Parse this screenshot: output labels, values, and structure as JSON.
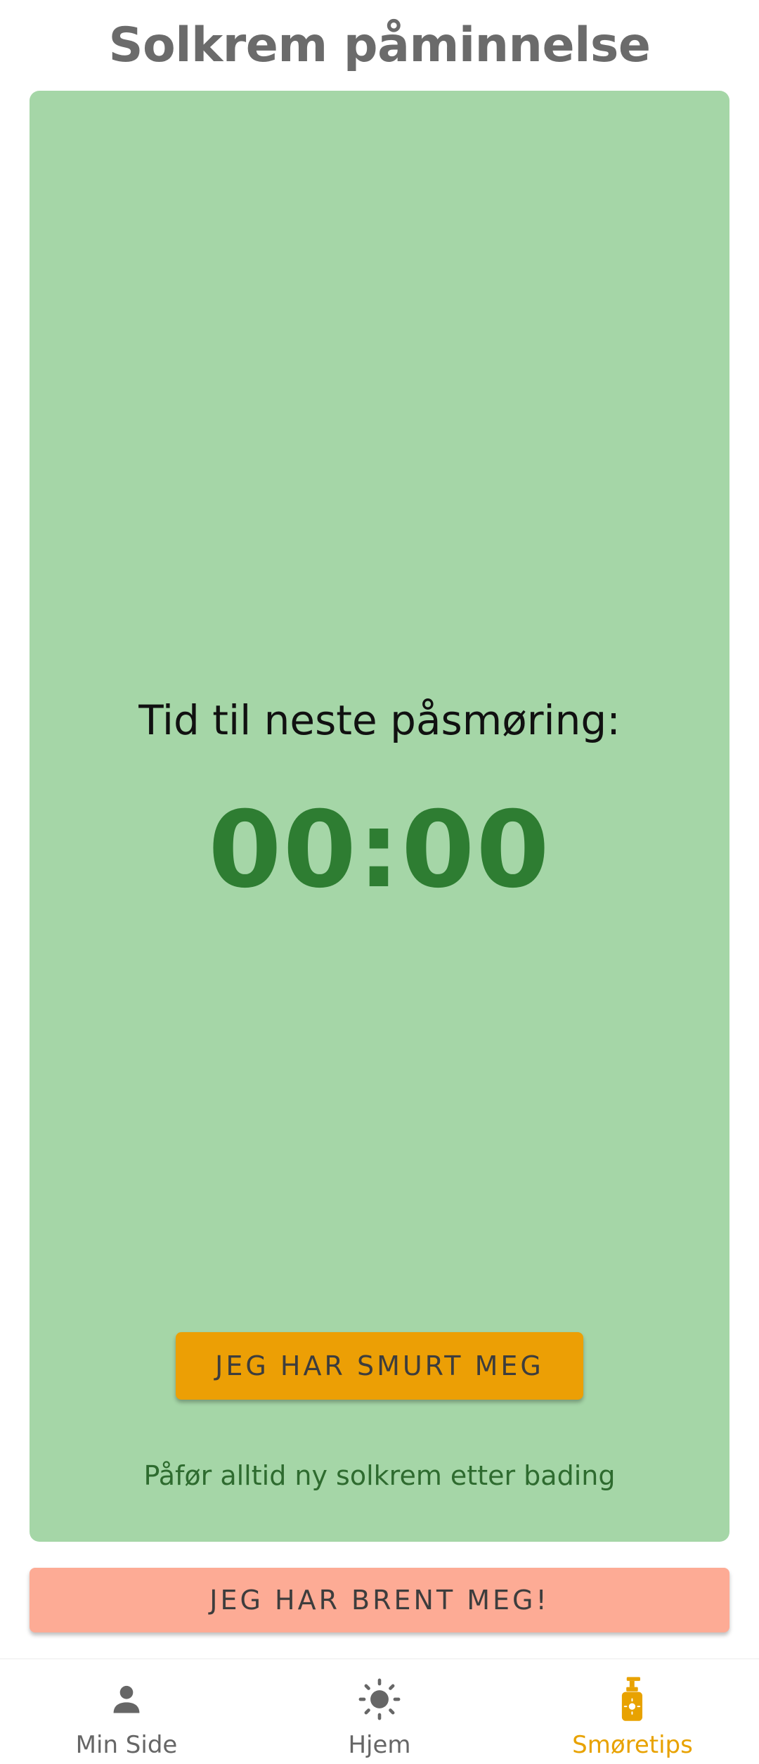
{
  "header": {
    "title": "Solkrem påminnelse"
  },
  "card": {
    "next_label": "Tid til neste påsmøring:",
    "timer": "00:00",
    "smurt_button": "JEG HAR SMURT MEG",
    "tip": "Påfør alltid ny solkrem etter bading"
  },
  "brent_button": "JEG HAR BRENT MEG!",
  "nav": {
    "items": [
      {
        "label": "Min Side",
        "icon": "person-icon"
      },
      {
        "label": "Hjem",
        "icon": "sun-icon"
      },
      {
        "label": "Smøretips",
        "icon": "sunscreen-bottle-icon",
        "active": true
      }
    ]
  },
  "colors": {
    "card_bg": "#a5d6a7",
    "timer": "#2e7d32",
    "accent": "#ec9f05",
    "danger_bg": "#fdab95",
    "nav_active": "#e8a200",
    "nav_inactive": "#666666"
  }
}
